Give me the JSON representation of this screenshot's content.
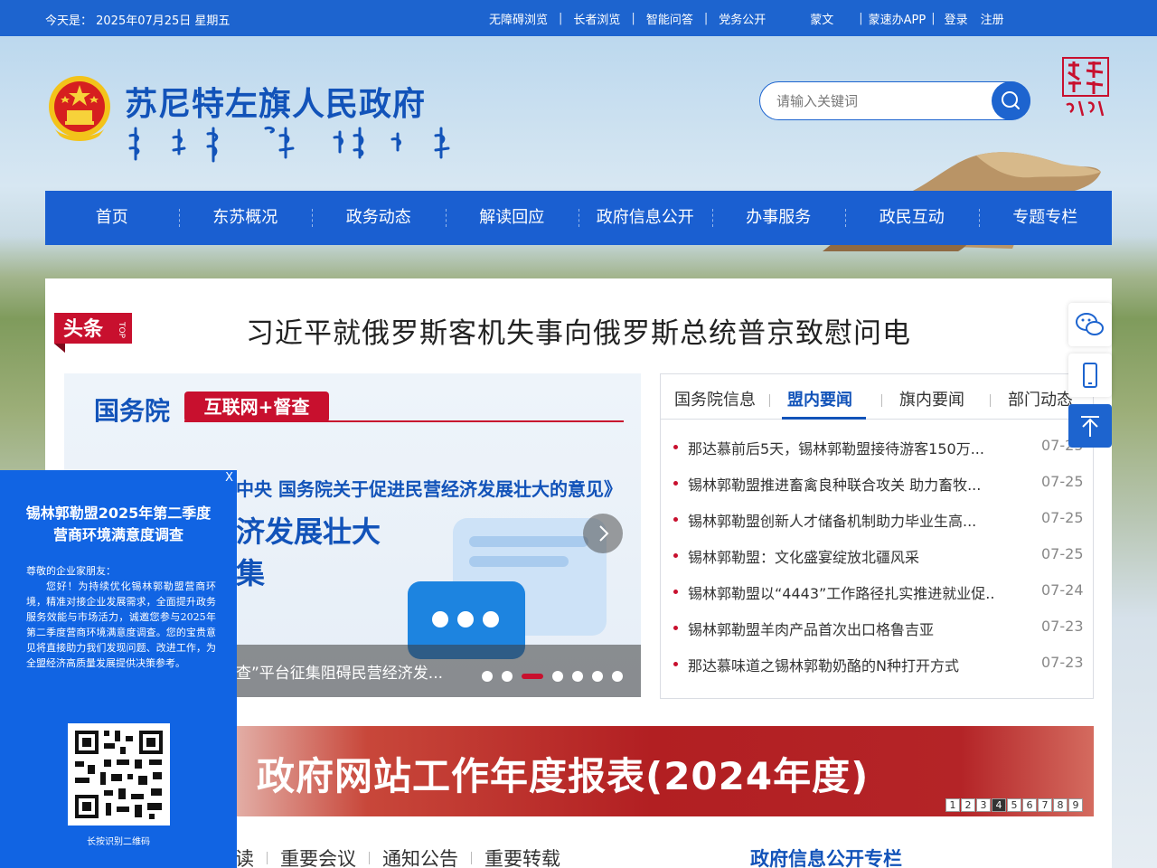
{
  "topbar": {
    "date": "今天是： 2025年07月25日 星期五",
    "links": [
      "无障碍浏览",
      "长者浏览",
      "智能问答",
      "党务公开",
      "蒙文",
      "蒙速办APP",
      "登录",
      "注册"
    ]
  },
  "header": {
    "title": "苏尼特左旗人民政府",
    "search_placeholder": "请输入关键词"
  },
  "nav": {
    "items": [
      "首页",
      "东苏概况",
      "政务动态",
      "解读回应",
      "政府信息公开",
      "办事服务",
      "政民互动",
      "专题专栏"
    ]
  },
  "headline": {
    "badge": "头条",
    "badge_sub": "TOP",
    "text": "习近平就俄罗斯客机失事向俄罗斯总统普京致慰问电"
  },
  "carousel": {
    "slide_label_1": "国务院",
    "slide_label_2": "互联网+督查",
    "slide_line": "中央 国务院关于促进民营经济发展壮大的意见》",
    "slide_big_1": "济发展壮大",
    "slide_big_2": "集",
    "caption": "查”平台征集阻碍民营经济发...",
    "dot_count": 7,
    "active_dot": 3
  },
  "news": {
    "tabs": [
      "国务院信息",
      "盟内要闻",
      "旗内要闻",
      "部门动态"
    ],
    "active_tab": "盟内要闻",
    "items": [
      {
        "title": "那达慕前后5天，锡林郭勒盟接待游客150万...",
        "date": "07-25"
      },
      {
        "title": "锡林郭勒盟推进畜禽良种联合攻关 助力畜牧...",
        "date": "07-25"
      },
      {
        "title": "锡林郭勒盟创新人才储备机制助力毕业生高...",
        "date": "07-25"
      },
      {
        "title": "锡林郭勒盟：文化盛宴绽放北疆风采",
        "date": "07-25"
      },
      {
        "title": "锡林郭勒盟以“4443”工作路径扎实推进就业促...",
        "date": "07-24"
      },
      {
        "title": "锡林郭勒盟羊肉产品首次出口格鲁吉亚",
        "date": "07-23"
      },
      {
        "title": "那达慕味道之锡林郭勒奶酪的N种打开方式",
        "date": "07-23"
      }
    ]
  },
  "report_banner": {
    "text": "政府网站工作年度报表(2024年度)",
    "pages": [
      "1",
      "2",
      "3",
      "4",
      "5",
      "6",
      "7",
      "8",
      "9"
    ],
    "active_page": "4"
  },
  "bottom": {
    "tabs": [
      "读",
      "重要会议",
      "通知公告",
      "重要转载"
    ],
    "column_title": "政府信息公开专栏"
  },
  "popup": {
    "close": "X",
    "title_line1": "锡林郭勒盟2025年第二季度",
    "title_line2": "营商环境满意度调查",
    "greeting": "尊敬的企业家朋友：",
    "body": "您好！为持续优化锡林郭勒盟营商环境，精准对接企业发展需求，全面提升政务服务效能与市场活力，诚邀您参与2025年第二季度营商环境满意度调查。您的宝贵意见将直接助力我们发现问题、改进工作，为全盟经济高质量发展提供决策参考。",
    "qr_caption": "长按识别二维码"
  },
  "colors": {
    "primary": "#1d64cf",
    "nav": "#1a5fd1",
    "accent_red": "#c8102e",
    "popup": "#1164e3"
  }
}
